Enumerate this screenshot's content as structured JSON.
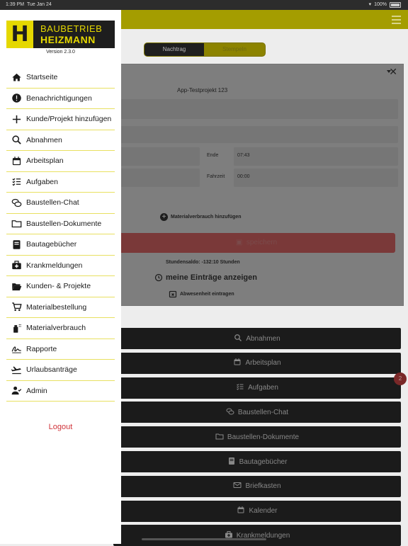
{
  "status": {
    "time": "1:39 PM",
    "date": "Tue Jan 24",
    "battery": "100%"
  },
  "segment": {
    "left": "Nachtrag",
    "right": "Stempeln"
  },
  "form": {
    "project": "App-Testprojekt 123",
    "end_label": "Ende",
    "end_value": "07:43",
    "drive_label": "Fahrzeit",
    "drive_value": "00:00",
    "material_add": "Materialverbrauch hinzufügen",
    "save": "speichern",
    "saldo": "Stundensaldo: -132:10 Stunden",
    "my_entries": "meine Einträge anzeigen",
    "absence": "Abwesenheit eintragen"
  },
  "nav_buttons": [
    {
      "label": "Abnahmen",
      "icon": "search-icon"
    },
    {
      "label": "Arbeitsplan",
      "icon": "calendar-icon"
    },
    {
      "label": "Aufgaben",
      "icon": "tasks-icon"
    },
    {
      "label": "Baustellen-Chat",
      "icon": "chat-icon"
    },
    {
      "label": "Baustellen-Dokumente",
      "icon": "folder-icon"
    },
    {
      "label": "Bautagebücher",
      "icon": "book-icon"
    },
    {
      "label": "Briefkasten",
      "icon": "mail-icon"
    },
    {
      "label": "Kalender",
      "icon": "calendar-icon"
    },
    {
      "label": "Krankmeldungen",
      "icon": "medkit-icon"
    }
  ],
  "badge": "2",
  "drawer": {
    "logo_line1": "BAUBETRIEB",
    "logo_line2": "HEIZMANN",
    "logo_letter": "H",
    "version": "Version 2.3.0",
    "items": [
      {
        "label": "Startseite",
        "icon": "home-icon"
      },
      {
        "label": "Benachrichtigungen",
        "icon": "alert-icon"
      },
      {
        "label": "Kunde/Projekt hinzufügen",
        "icon": "plus-icon"
      },
      {
        "label": "Abnahmen",
        "icon": "search-icon"
      },
      {
        "label": "Arbeitsplan",
        "icon": "calendar-icon"
      },
      {
        "label": "Aufgaben",
        "icon": "tasks-icon"
      },
      {
        "label": "Baustellen-Chat",
        "icon": "chat-icon"
      },
      {
        "label": "Baustellen-Dokumente",
        "icon": "folder-icon"
      },
      {
        "label": "Bautagebücher",
        "icon": "book-icon"
      },
      {
        "label": "Krankmeldungen",
        "icon": "medkit-icon"
      },
      {
        "label": "Kunden- & Projekte",
        "icon": "folder-open-icon"
      },
      {
        "label": "Materialbestellung",
        "icon": "cart-icon"
      },
      {
        "label": "Materialverbrauch",
        "icon": "spray-icon"
      },
      {
        "label": "Rapporte",
        "icon": "signature-icon"
      },
      {
        "label": "Urlaubsanträge",
        "icon": "plane-icon"
      },
      {
        "label": "Admin",
        "icon": "user-check-icon"
      }
    ],
    "logout": "Logout"
  },
  "colors": {
    "brand_yellow": "#e5d800",
    "logout_red": "#d0343a",
    "save_red": "#d9534f"
  }
}
